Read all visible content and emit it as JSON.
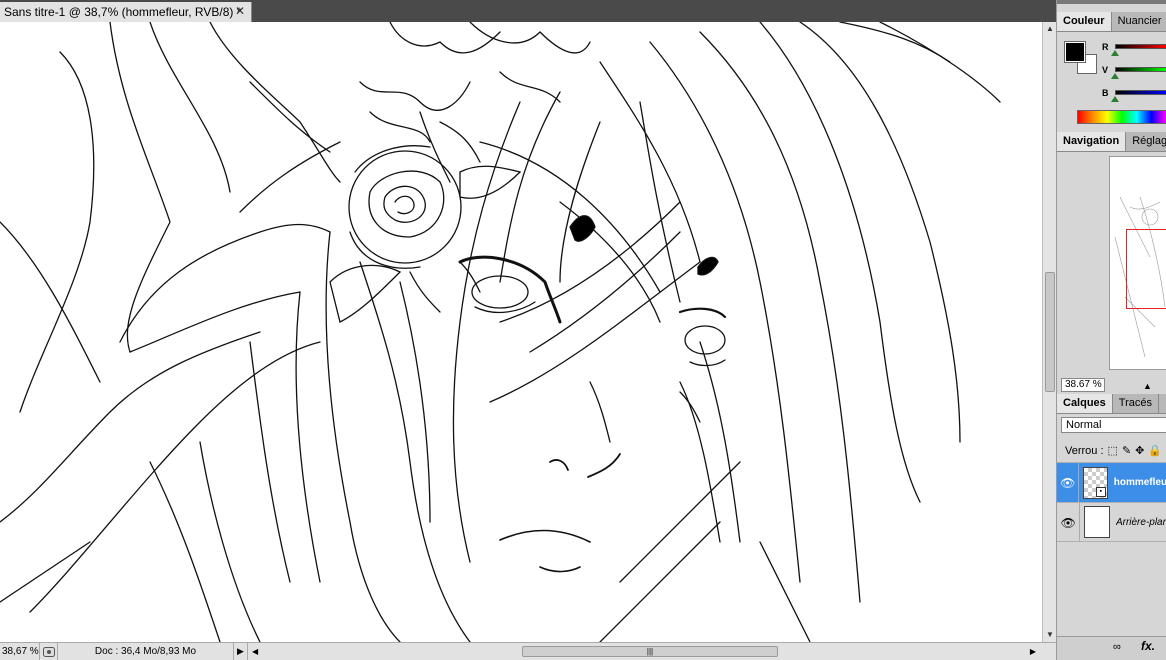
{
  "document": {
    "tab_title": "Sans titre-1 @ 38,7% (hommefleur, RVB/8) *",
    "close_glyph": "✕"
  },
  "status": {
    "zoom": "38,67 %",
    "doc_info": "Doc : 36,4 Mo/8,93 Mo"
  },
  "color_panel": {
    "tabs": [
      "Couleur",
      "Nuancier"
    ],
    "channels": [
      "R",
      "V",
      "B"
    ],
    "foreground": "#000000",
    "background": "#ffffff"
  },
  "navigation_panel": {
    "tabs": [
      "Navigation",
      "Réglages"
    ],
    "zoom": "38.67 %"
  },
  "layers_panel": {
    "tabs": [
      "Calques",
      "Tracés"
    ],
    "blend_mode": "Normal",
    "lock_label": "Verrou :",
    "layers": [
      {
        "name": "hommefleur",
        "selected": true
      },
      {
        "name": "Arrière-plan",
        "selected": false
      }
    ]
  },
  "colors": {
    "selection": "#3d8ee6",
    "nav_view_box": "#e62020"
  }
}
